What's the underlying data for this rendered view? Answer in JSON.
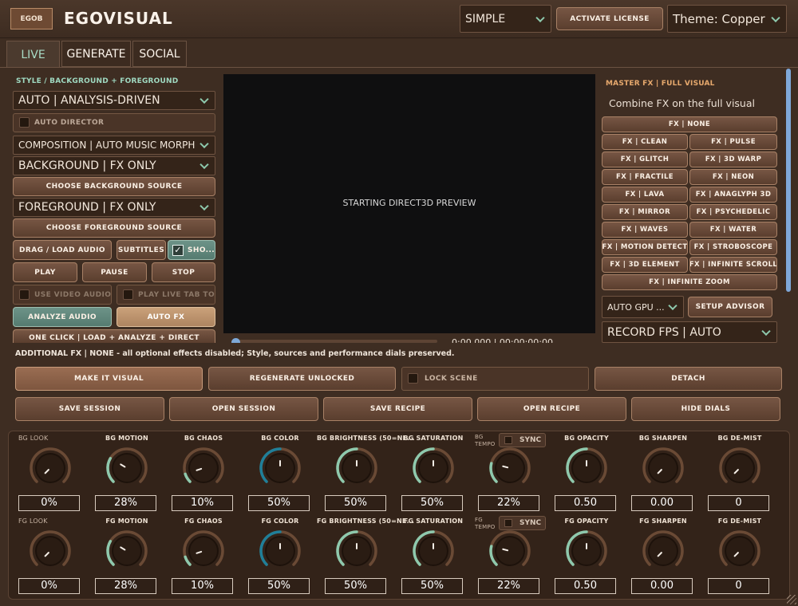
{
  "header": {
    "logo_badge": "EGOB",
    "title": "EGOVISUAL",
    "mode_select": "SIMPLE",
    "activate_label": "ACTIVATE LICENSE",
    "theme_select": "Theme: Copper"
  },
  "tabs": [
    "LIVE",
    "GENERATE",
    "SOCIAL"
  ],
  "left": {
    "section_title": "STYLE / BACKGROUND + FOREGROUND",
    "style_select": "AUTO | ANALYSIS-DRIVEN",
    "auto_director": "AUTO DIRECTOR",
    "composition_select": "COMPOSITION | AUTO MUSIC MORPH",
    "background_select": "BACKGROUND | FX ONLY",
    "choose_bg": "CHOOSE BACKGROUND SOURCE",
    "foreground_select": "FOREGROUND | FX ONLY",
    "choose_fg": "CHOOSE FOREGROUND SOURCE",
    "drag_audio": "DRAG / LOAD AUDIO",
    "subtitles": "SUBTITLES",
    "show": "SHO...",
    "play": "PLAY",
    "pause": "PAUSE",
    "stop": "STOP",
    "use_video_audio": "USE VIDEO AUDIO",
    "play_live_tab": "PLAY LIVE TAB TOO",
    "analyze_audio": "ANALYZE AUDIO",
    "auto_fx": "AUTO FX",
    "one_click": "ONE CLICK | LOAD + ANALYZE + DIRECT"
  },
  "preview": {
    "text": "STARTING DIRECT3D PREVIEW",
    "time": "0:00.000 | 00:00:00:00"
  },
  "right": {
    "title": "MASTER FX | FULL VISUAL",
    "subtitle": "Combine FX on the full visual",
    "fx_none": "FX | NONE",
    "fx_grid": [
      [
        "FX | CLEAN",
        "FX | PULSE"
      ],
      [
        "FX | GLITCH",
        "FX | 3D WARP"
      ],
      [
        "FX | FRACTILE",
        "FX | NEON"
      ],
      [
        "FX | LAVA",
        "FX | ANAGLYPH 3D"
      ],
      [
        "FX | MIRROR",
        "FX | PSYCHEDELIC"
      ],
      [
        "FX | WAVES",
        "FX | WATER"
      ],
      [
        "FX | MOTION DETECT",
        "FX | STROBOSCOPE"
      ],
      [
        "FX | 3D ELEMENT",
        "FX | INFINITE SCROLL"
      ]
    ],
    "fx_infinite_zoom": "FX | INFINITE ZOOM",
    "gpu_select": "AUTO GPU ...",
    "setup_advisor": "SETUP ADVISOR",
    "record_fps": "RECORD FPS | AUTO"
  },
  "status_line": "ADDITIONAL FX | NONE - all optional effects disabled; Style, sources and performance dials preserved.",
  "actions1": {
    "make_visual": "MAKE IT VISUAL",
    "regenerate": "REGENERATE UNLOCKED",
    "lock_scene": "LOCK SCENE",
    "detach": "DETACH"
  },
  "actions2": [
    "SAVE SESSION",
    "OPEN SESSION",
    "SAVE RECIPE",
    "OPEN RECIPE",
    "HIDE DIALS"
  ],
  "dials": {
    "sync": "SYNC",
    "bg": [
      {
        "label": "BG LOOK",
        "value": "0%",
        "level": 0.0,
        "dim": true
      },
      {
        "label": "BG MOTION",
        "value": "28%",
        "level": 0.28
      },
      {
        "label": "BG CHAOS",
        "value": "10%",
        "level": 0.1
      },
      {
        "label": "BG COLOR",
        "value": "50%",
        "level": 0.5,
        "blue": true
      },
      {
        "label": "BG BRIGHTNESS (50=NE...",
        "value": "50%",
        "level": 0.5
      },
      {
        "label": "BG SATURATION",
        "value": "50%",
        "level": 0.5
      },
      {
        "label": "BG TEMPO",
        "value": "22%",
        "level": 0.22,
        "tempo": true
      },
      {
        "label": "BG OPACITY",
        "value": "0.50",
        "level": 0.5
      },
      {
        "label": "BG SHARPEN",
        "value": "0.00",
        "level": 0.0
      },
      {
        "label": "BG DE-MIST",
        "value": "0",
        "level": 0.0
      }
    ],
    "fg": [
      {
        "label": "FG LOOK",
        "value": "0%",
        "level": 0.0,
        "dim": true
      },
      {
        "label": "FG MOTION",
        "value": "28%",
        "level": 0.28
      },
      {
        "label": "FG CHAOS",
        "value": "10%",
        "level": 0.1
      },
      {
        "label": "FG COLOR",
        "value": "50%",
        "level": 0.5,
        "blue": true
      },
      {
        "label": "FG BRIGHTNESS (50=NE...",
        "value": "50%",
        "level": 0.5
      },
      {
        "label": "FG SATURATION",
        "value": "50%",
        "level": 0.5
      },
      {
        "label": "FG TEMPO",
        "value": "22%",
        "level": 0.22,
        "tempo": true
      },
      {
        "label": "FG OPACITY",
        "value": "0.50",
        "level": 0.5
      },
      {
        "label": "FG SHARPEN",
        "value": "0.00",
        "level": 0.0
      },
      {
        "label": "FG DE-MIST",
        "value": "0",
        "level": 0.0
      }
    ]
  },
  "colors": {
    "accent": "#8ec9ad",
    "copper": "#b07a55",
    "section_title": "#9fd9c1",
    "master_fx_title": "#e7a96d"
  }
}
